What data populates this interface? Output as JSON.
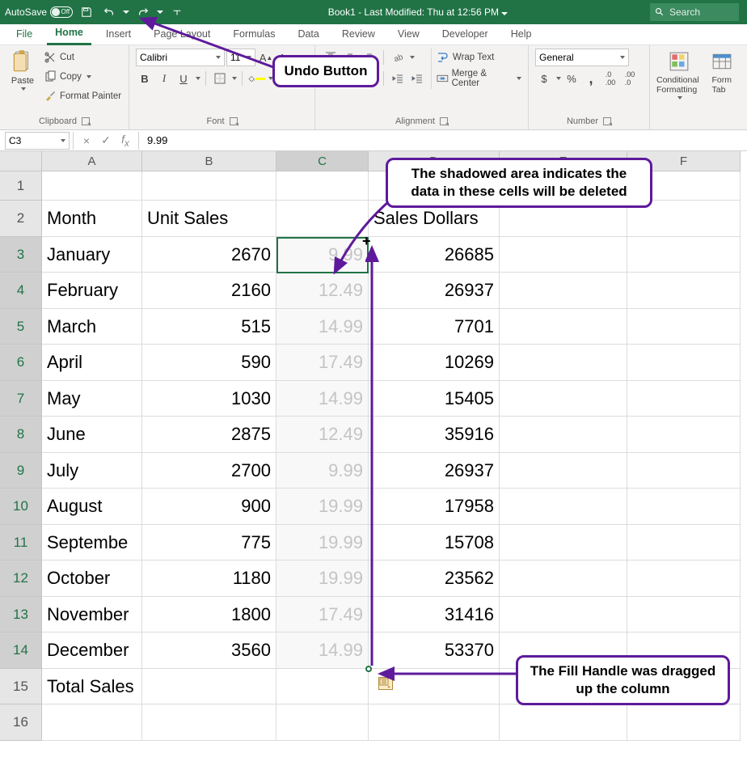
{
  "title": "Book1  -  Last Modified: Thu at 12:56 PM",
  "autosave_label": "AutoSave",
  "autosave_state": "Off",
  "search_placeholder": "Search",
  "tabs": [
    "File",
    "Home",
    "Insert",
    "Page Layout",
    "Formulas",
    "Data",
    "Review",
    "View",
    "Developer",
    "Help"
  ],
  "active_tab": "Home",
  "ribbon": {
    "clipboard": {
      "paste": "Paste",
      "cut": "Cut",
      "copy": "Copy",
      "fp": "Format Painter",
      "label": "Clipboard"
    },
    "font": {
      "name": "Calibri",
      "size": "11",
      "label": "Font"
    },
    "alignment": {
      "wrap": "Wrap Text",
      "merge": "Merge & Center",
      "label": "Alignment"
    },
    "number": {
      "format": "General",
      "label": "Number"
    },
    "styles": {
      "cf": "Conditional Formatting",
      "ft": "Format as Table"
    }
  },
  "name_box": "C3",
  "formula_value": "9.99",
  "columns": [
    "A",
    "B",
    "C",
    "D",
    "E",
    "F"
  ],
  "selected_col": "C",
  "selected_rows": [
    3,
    4,
    5,
    6,
    7,
    8,
    9,
    10,
    11,
    12,
    13,
    14
  ],
  "data_rows": [
    {
      "r": 2,
      "a": "Month",
      "b": "Unit Sales",
      "c": "",
      "d": "Sales Dollars"
    },
    {
      "r": 3,
      "a": "January",
      "b": "2670",
      "c": "9.99",
      "d": "26685"
    },
    {
      "r": 4,
      "a": "February",
      "b": "2160",
      "c": "12.49",
      "d": "26937"
    },
    {
      "r": 5,
      "a": "March",
      "b": "515",
      "c": "14.99",
      "d": "7701"
    },
    {
      "r": 6,
      "a": "April",
      "b": "590",
      "c": "17.49",
      "d": "10269"
    },
    {
      "r": 7,
      "a": "May",
      "b": "1030",
      "c": "14.99",
      "d": "15405"
    },
    {
      "r": 8,
      "a": "June",
      "b": "2875",
      "c": "12.49",
      "d": "35916"
    },
    {
      "r": 9,
      "a": "July",
      "b": "2700",
      "c": "9.99",
      "d": "26937"
    },
    {
      "r": 10,
      "a": "August",
      "b": "900",
      "c": "19.99",
      "d": "17958"
    },
    {
      "r": 11,
      "a": "Septembe",
      "b": "775",
      "c": "19.99",
      "d": "15708"
    },
    {
      "r": 12,
      "a": "October",
      "b": "1180",
      "c": "19.99",
      "d": "23562"
    },
    {
      "r": 13,
      "a": "November",
      "b": "1800",
      "c": "17.49",
      "d": "31416"
    },
    {
      "r": 14,
      "a": "December",
      "b": "3560",
      "c": "14.99",
      "d": "53370"
    },
    {
      "r": 15,
      "a": "Total Sales",
      "b": "",
      "c": "",
      "d": ""
    },
    {
      "r": 16,
      "a": "",
      "b": "",
      "c": "",
      "d": ""
    }
  ],
  "callouts": {
    "undo": "Undo Button",
    "shadow": "The shadowed area indicates the data in these cells will be deleted",
    "fill": "The Fill Handle was dragged up the column"
  }
}
